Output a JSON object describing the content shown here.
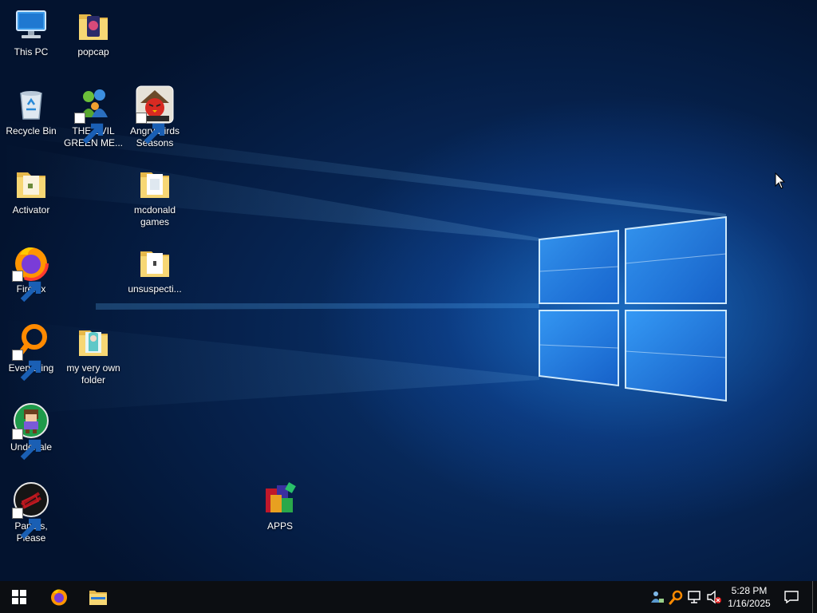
{
  "desktop": {
    "icons": [
      {
        "label": "This PC",
        "icon": "this-pc-icon"
      },
      {
        "label": "popcap",
        "icon": "folder-icon"
      },
      {
        "label": "Recycle Bin",
        "icon": "recycle-bin-icon"
      },
      {
        "label": "THE EVIL GREEN ME...",
        "icon": "messenger-icon"
      },
      {
        "label": "Angry Birds Seasons",
        "icon": "angry-birds-icon"
      },
      {
        "label": "Activator",
        "icon": "folder-icon"
      },
      {
        "label": "mcdonald games",
        "icon": "folder-icon"
      },
      {
        "label": "Firefox",
        "icon": "firefox-icon"
      },
      {
        "label": "unsuspecti...",
        "icon": "folder-icon"
      },
      {
        "label": "Everything",
        "icon": "everything-search-icon"
      },
      {
        "label": "my very own folder",
        "icon": "folder-icon"
      },
      {
        "label": "Undertale",
        "icon": "undertale-icon"
      },
      {
        "label": "Papers, Please",
        "icon": "papers-please-icon"
      },
      {
        "label": "APPS",
        "icon": "winrar-icon"
      }
    ]
  },
  "taskbar": {
    "pinned": [
      {
        "name": "start-button",
        "icon": "windows-logo-icon"
      },
      {
        "name": "firefox",
        "icon": "firefox-icon"
      },
      {
        "name": "file-explorer",
        "icon": "folder-icon"
      }
    ],
    "tray": {
      "icons": [
        "people-network-icon",
        "everything-search-icon",
        "network-icon",
        "volume-muted-icon"
      ],
      "time": "5:28 PM",
      "date": "1/16/2025"
    }
  },
  "colors": {
    "taskbar": "#0c0e12",
    "wallpaper_dark": "#041634",
    "wallpaper_glow": "#2896ff"
  }
}
